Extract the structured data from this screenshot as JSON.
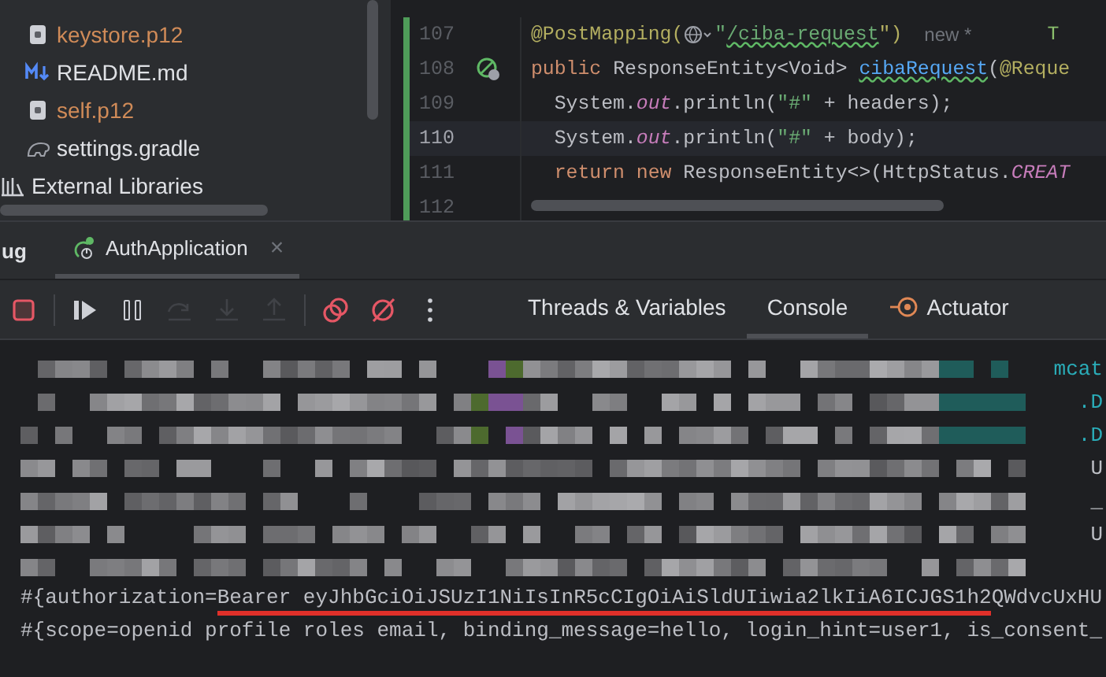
{
  "project_tree": [
    {
      "children": [
        {
          "label": "keystore.p12",
          "kind": "keystore",
          "modified": true
        },
        {
          "label": "README.md",
          "kind": "markdown",
          "modified": false
        },
        {
          "label": "self.p12",
          "kind": "keystore",
          "modified": true
        },
        {
          "label": "settings.gradle",
          "kind": "gradle",
          "modified": false
        }
      ]
    },
    {
      "label": "External Libraries",
      "kind": "library",
      "modified": false
    }
  ],
  "editor": {
    "lines": [
      {
        "number": "107",
        "current": false,
        "gutter_icon": false,
        "tokens": [
          {
            "text": "@PostMapping(",
            "kind": "annotation"
          },
          {
            "kind": "globe"
          },
          {
            "text": "\"",
            "kind": "string"
          },
          {
            "text": "/ciba-request",
            "kind": "string_link"
          },
          {
            "text": "\")",
            "kind": "annotation"
          },
          {
            "text": "new *",
            "kind": "hint"
          },
          {
            "text": "T",
            "kind": "author"
          }
        ]
      },
      {
        "number": "108",
        "current": false,
        "gutter_icon": true,
        "tokens": [
          {
            "text": "public ",
            "kind": "keyword"
          },
          {
            "text": "ResponseEntity<Void> ",
            "kind": "plain"
          },
          {
            "text": "cibaRequest",
            "kind": "method"
          },
          {
            "text": "(",
            "kind": "plain"
          },
          {
            "text": "@Reque",
            "kind": "annotation"
          }
        ]
      },
      {
        "number": "109",
        "current": false,
        "gutter_icon": false,
        "tokens": [
          {
            "text": "  System.",
            "kind": "plain"
          },
          {
            "text": "out",
            "kind": "field"
          },
          {
            "text": ".println(",
            "kind": "plain"
          },
          {
            "text": "\"#\"",
            "kind": "string"
          },
          {
            "text": " + headers);",
            "kind": "plain"
          }
        ]
      },
      {
        "number": "110",
        "current": true,
        "gutter_icon": false,
        "tokens": [
          {
            "text": "  System.",
            "kind": "plain"
          },
          {
            "text": "out",
            "kind": "field"
          },
          {
            "text": ".println(",
            "kind": "plain"
          },
          {
            "text": "\"#\"",
            "kind": "string"
          },
          {
            "text": " + body);",
            "kind": "plain"
          }
        ]
      },
      {
        "number": "111",
        "current": false,
        "gutter_icon": false,
        "tokens": [
          {
            "text": "  return new ",
            "kind": "keyword"
          },
          {
            "text": "ResponseEntity<>(HttpStatus.",
            "kind": "plain"
          },
          {
            "text": "CREAT",
            "kind": "constant"
          }
        ]
      },
      {
        "number": "112",
        "current": false,
        "gutter_icon": false
      }
    ]
  },
  "tool_window": {
    "title": "ug",
    "tabs": [
      {
        "label": "AuthApplication",
        "selected": true,
        "close": "×"
      }
    ]
  },
  "toolbar": [
    {
      "kind": "stop",
      "disabled": false
    },
    {
      "kind": "sep"
    },
    {
      "kind": "resume",
      "disabled": false
    },
    {
      "kind": "pause",
      "disabled": false
    },
    {
      "kind": "step_over",
      "disabled": true
    },
    {
      "kind": "step_into",
      "disabled": true
    },
    {
      "kind": "step_out",
      "disabled": true
    },
    {
      "kind": "sep"
    },
    {
      "kind": "breakpoints",
      "disabled": false
    },
    {
      "kind": "mute",
      "disabled": false
    },
    {
      "kind": "more",
      "disabled": false
    }
  ],
  "debug_tabs": [
    {
      "label": "Threads & Variables",
      "selected": false,
      "icon": false
    },
    {
      "label": "Console",
      "selected": true,
      "icon": false
    },
    {
      "label": "Actuator",
      "selected": false,
      "icon": true
    }
  ],
  "console": {
    "lines": [
      {
        "kind": "pixelated",
        "tail": "mcat"
      },
      {
        "kind": "pixelated",
        "tail": ".D"
      },
      {
        "kind": "pixelated",
        "tail": ".D"
      },
      {
        "kind": "pixelated",
        "tail": "U"
      },
      {
        "kind": "pixelated",
        "tail": "_"
      },
      {
        "kind": "pixelated",
        "tail": "U"
      },
      {
        "kind": "pixelated"
      },
      {
        "kind": "text",
        "parts": [
          {
            "text": "#{authorization=",
            "underlined": false
          },
          {
            "text": "Bearer eyJhbGciOiJSUzI1NiIsInR5cCIgOiAiSldUIiwia2lkIiA6ICJGS1h2",
            "underlined": true
          },
          {
            "text": "QWdvcUxHU",
            "underlined": false
          }
        ]
      },
      {
        "kind": "text",
        "parts": [
          {
            "text": "#{scope=openid profile roles email, binding_message=hello, login_hint=user1, is_consent_",
            "underlined": false
          }
        ]
      }
    ]
  }
}
